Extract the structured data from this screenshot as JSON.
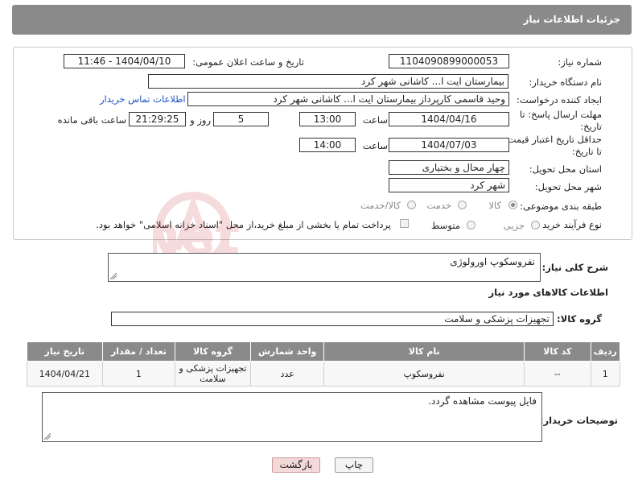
{
  "header": {
    "title": "جزئیات اطلاعات نیاز"
  },
  "form": {
    "need_number_label": "شماره نیاز:",
    "need_number": "1104090899000053",
    "announce_label": "تاریخ و ساعت اعلان عمومی:",
    "announce_value": "1404/04/10 - 11:46",
    "buyer_org_label": "نام دستگاه خریدار:",
    "buyer_org": "بیمارستان ایت ا... کاشانی شهر کرد",
    "requester_label": "ایجاد کننده درخواست:",
    "requester": "وحید قاسمی کارپرداز بیمارستان ایت ا... کاشانی شهر کرد",
    "contact_link": "اطلاعات تماس خریدار",
    "deadline_label_1": "مهلت ارسال پاسخ: تا",
    "deadline_label_2": "تاریخ:",
    "deadline_date": "1404/04/16",
    "time_label": "ساعت",
    "deadline_time": "13:00",
    "days_value": "5",
    "days_label": "روز و",
    "remaining_time": "21:29:25",
    "remaining_label": "ساعت باقی مانده",
    "price_validity_label_1": "حداقل تاریخ اعتبار قیمت:",
    "price_validity_label_2": "تا تاریخ:",
    "price_validity_date": "1404/07/03",
    "price_validity_time": "14:00",
    "province_label": "استان محل تحویل:",
    "province": "چهار محال و بختیاری",
    "city_label": "شهر محل تحویل:",
    "city": "شهر کرد",
    "category_label": "طبقه بندی موضوعی:",
    "category_options": [
      "کالا",
      "خدمت",
      "کالا/خدمت"
    ],
    "category_selected": "کالا",
    "process_label": "نوع فرآیند خرید :",
    "process_options": [
      "جزیی",
      "متوسط"
    ],
    "payment_note": "پرداخت تمام یا بخشی از مبلغ خرید،از محل \"اسناد خزانه اسلامی\" خواهد بود."
  },
  "description": {
    "label": "شرح کلی نیاز:",
    "value": "نفروسکوپ اورولوژی"
  },
  "goods_info": {
    "title": "اطلاعات کالاهای مورد نیاز",
    "group_label": "گروه کالا:",
    "group_value": "تجهیزات پزشکی و سلامت"
  },
  "table": {
    "headers": [
      "ردیف",
      "کد کالا",
      "نام کالا",
      "واحد شمارش",
      "گروه کالا",
      "تعداد / مقدار",
      "تاریخ نیاز"
    ],
    "rows": [
      [
        "1",
        "--",
        "نفروسکوپ",
        "عدد",
        "تجهیزات پزشکی و سلامت",
        "1",
        "1404/04/21"
      ]
    ]
  },
  "buyer_notes": {
    "label": "توضیحات خریدار:",
    "value": "فایل پیوست مشاهده گردد."
  },
  "buttons": {
    "print": "چاپ",
    "back": "بازگشت"
  },
  "watermark": {
    "text": "AriaTender.net"
  },
  "colors": {
    "header_bg": "#8a8a8a",
    "link": "#1a56c4",
    "back_button_bg": "#f4d9d9"
  }
}
